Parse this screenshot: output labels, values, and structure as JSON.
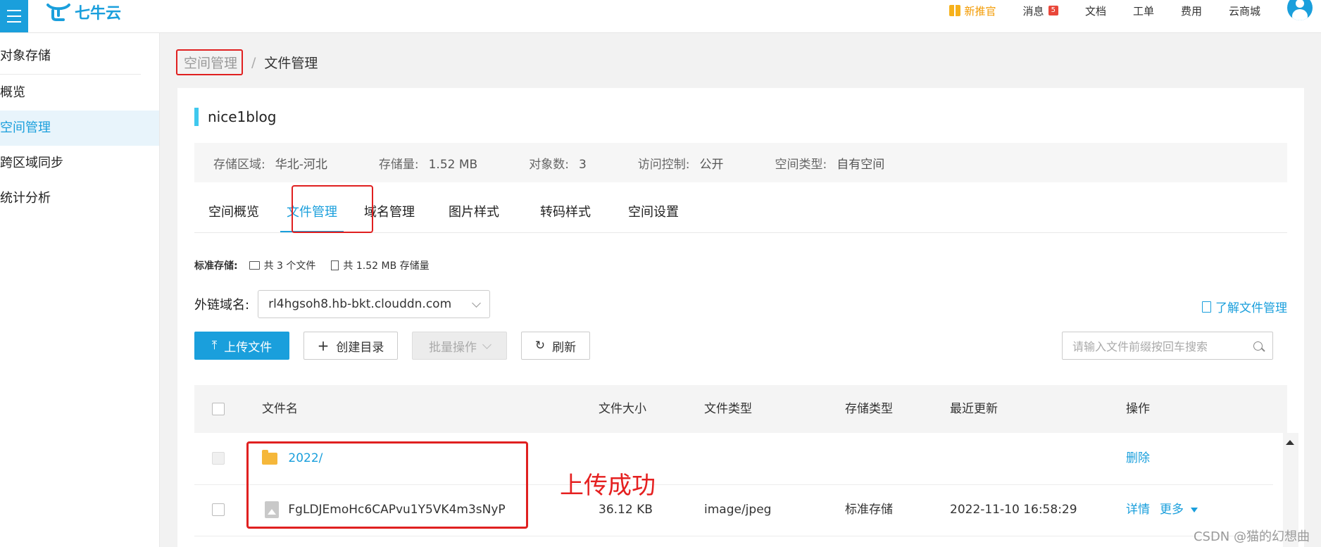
{
  "topbar": {
    "logo_text": "七牛云",
    "nav": [
      {
        "label": "新推官"
      },
      {
        "label": "消息",
        "badge": "5"
      },
      {
        "label": "文档"
      },
      {
        "label": "工单"
      },
      {
        "label": "费用"
      },
      {
        "label": "云商城"
      }
    ]
  },
  "sidebar": {
    "title": "对象存储",
    "items": [
      {
        "label": "概览",
        "active": false
      },
      {
        "label": "空间管理",
        "active": true
      },
      {
        "label": "跨区域同步",
        "active": false
      },
      {
        "label": "统计分析",
        "active": false
      }
    ]
  },
  "breadcrumb": {
    "parent": "空间管理",
    "separator": "/",
    "current": "文件管理"
  },
  "bucket": {
    "name": "nice1blog",
    "info": [
      {
        "label": "存储区域:",
        "value": "华北-河北"
      },
      {
        "label": "存储量:",
        "value": "1.52 MB"
      },
      {
        "label": "对象数:",
        "value": "3"
      },
      {
        "label": "访问控制:",
        "value": "公开"
      },
      {
        "label": "空间类型:",
        "value": "自有空间"
      }
    ]
  },
  "tabs": [
    {
      "label": "空间概览"
    },
    {
      "label": "文件管理",
      "active": true
    },
    {
      "label": "域名管理"
    },
    {
      "label": "图片样式"
    },
    {
      "label": "转码样式"
    },
    {
      "label": "空间设置"
    }
  ],
  "stats": {
    "label": "标准存储:",
    "files": "共 3 个文件",
    "storage": "共 1.52 MB 存储量"
  },
  "domain": {
    "label": "外链域名:",
    "value": "rl4hgsoh8.hb-bkt.clouddn.com"
  },
  "learn_link": "了解文件管理",
  "toolbar": {
    "upload": "上传文件",
    "create_dir": "创建目录",
    "batch": "批量操作",
    "refresh": "刷新"
  },
  "search": {
    "placeholder": "请输入文件前缀按回车搜索"
  },
  "table": {
    "headers": [
      "文件名",
      "文件大小",
      "文件类型",
      "存储类型",
      "最近更新",
      "操作"
    ],
    "rows": [
      {
        "name": "2022/",
        "size": "",
        "type": "",
        "storage": "",
        "updated": "",
        "actions": [
          "删除"
        ]
      },
      {
        "name": "FgLDJEmoHc6CAPvu1Y5VK4m3sNyP",
        "size": "36.12 KB",
        "type": "image/jpeg",
        "storage": "标准存储",
        "updated": "2022-11-10 16:58:29",
        "actions": [
          "详情",
          "更多"
        ]
      }
    ]
  },
  "annotation": "上传成功",
  "watermark": "CSDN @猫的幻想曲",
  "colors": {
    "accent": "#1a9fdc",
    "highlight_box": "#e02020",
    "promo": "#f39a00"
  }
}
